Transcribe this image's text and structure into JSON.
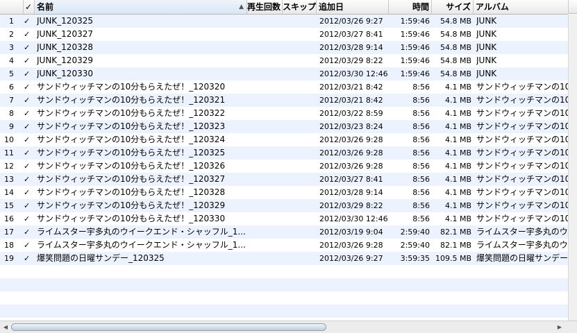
{
  "columns": {
    "check": "✓",
    "name": "名前",
    "plays": "再生回数",
    "skips": "スキップ回数",
    "date_added": "追加日",
    "time": "時間",
    "size": "サイズ",
    "album": "アルバム"
  },
  "rows": [
    {
      "num": "1",
      "check": "✓",
      "name": "JUNK_120325",
      "date": "2012/03/26 9:27",
      "time": "1:59:46",
      "size": "54.8 MB",
      "album": "JUNK"
    },
    {
      "num": "2",
      "check": "✓",
      "name": "JUNK_120327",
      "date": "2012/03/27 8:41",
      "time": "1:59:46",
      "size": "54.8 MB",
      "album": "JUNK"
    },
    {
      "num": "3",
      "check": "✓",
      "name": "JUNK_120328",
      "date": "2012/03/28 9:14",
      "time": "1:59:46",
      "size": "54.8 MB",
      "album": "JUNK"
    },
    {
      "num": "4",
      "check": "✓",
      "name": "JUNK_120329",
      "date": "2012/03/29 8:22",
      "time": "1:59:46",
      "size": "54.8 MB",
      "album": "JUNK"
    },
    {
      "num": "5",
      "check": "✓",
      "name": "JUNK_120330",
      "date": "2012/03/30 12:46",
      "time": "1:59:46",
      "size": "54.8 MB",
      "album": "JUNK"
    },
    {
      "num": "6",
      "check": "✓",
      "name": "サンドウィッチマンの10分もらえたぜ！_120320",
      "date": "2012/03/21 8:42",
      "time": "8:56",
      "size": "4.1 MB",
      "album": "サンドウィッチマンの10"
    },
    {
      "num": "7",
      "check": "✓",
      "name": "サンドウィッチマンの10分もらえたぜ！_120321",
      "date": "2012/03/21 8:42",
      "time": "8:56",
      "size": "4.1 MB",
      "album": "サンドウィッチマンの10"
    },
    {
      "num": "8",
      "check": "✓",
      "name": "サンドウィッチマンの10分もらえたぜ！_120322",
      "date": "2012/03/22 8:59",
      "time": "8:56",
      "size": "4.1 MB",
      "album": "サンドウィッチマンの10"
    },
    {
      "num": "9",
      "check": "✓",
      "name": "サンドウィッチマンの10分もらえたぜ！_120323",
      "date": "2012/03/23 8:24",
      "time": "8:56",
      "size": "4.1 MB",
      "album": "サンドウィッチマンの10"
    },
    {
      "num": "10",
      "check": "✓",
      "name": "サンドウィッチマンの10分もらえたぜ！_120324",
      "date": "2012/03/26 9:28",
      "time": "8:56",
      "size": "4.1 MB",
      "album": "サンドウィッチマンの10"
    },
    {
      "num": "11",
      "check": "✓",
      "name": "サンドウィッチマンの10分もらえたぜ！_120325",
      "date": "2012/03/26 9:28",
      "time": "8:56",
      "size": "4.1 MB",
      "album": "サンドウィッチマンの10"
    },
    {
      "num": "12",
      "check": "✓",
      "name": "サンドウィッチマンの10分もらえたぜ！_120326",
      "date": "2012/03/26 9:28",
      "time": "8:56",
      "size": "4.1 MB",
      "album": "サンドウィッチマンの10"
    },
    {
      "num": "13",
      "check": "✓",
      "name": "サンドウィッチマンの10分もらえたぜ！_120327",
      "date": "2012/03/27 8:41",
      "time": "8:56",
      "size": "4.1 MB",
      "album": "サンドウィッチマンの10"
    },
    {
      "num": "14",
      "check": "✓",
      "name": "サンドウィッチマンの10分もらえたぜ！_120328",
      "date": "2012/03/28 9:14",
      "time": "8:56",
      "size": "4.1 MB",
      "album": "サンドウィッチマンの10"
    },
    {
      "num": "15",
      "check": "✓",
      "name": "サンドウィッチマンの10分もらえたぜ！_120329",
      "date": "2012/03/29 8:22",
      "time": "8:56",
      "size": "4.1 MB",
      "album": "サンドウィッチマンの10"
    },
    {
      "num": "16",
      "check": "✓",
      "name": "サンドウィッチマンの10分もらえたぜ！_120330",
      "date": "2012/03/30 12:46",
      "time": "8:56",
      "size": "4.1 MB",
      "album": "サンドウィッチマンの10"
    },
    {
      "num": "17",
      "check": "✓",
      "name": "ライムスター宇多丸のウイークエンド・シャッフル_1...",
      "date": "2012/03/19 9:04",
      "time": "2:59:40",
      "size": "82.1 MB",
      "album": "ライムスター宇多丸のウ"
    },
    {
      "num": "18",
      "check": "✓",
      "name": "ライムスター宇多丸のウイークエンド・シャッフル_1...",
      "date": "2012/03/26 9:28",
      "time": "2:59:40",
      "size": "82.1 MB",
      "album": "ライムスター宇多丸のウ"
    },
    {
      "num": "19",
      "check": "✓",
      "name": "爆笑問題の日曜サンデー_120325",
      "date": "2012/03/26 9:27",
      "time": "3:59:35",
      "size": "109.5 MB",
      "album": "爆笑問題の日曜サンデー"
    }
  ],
  "icons": {
    "sort": "sort-ascending-icon",
    "scroll_left": "scroll-left-arrow-icon",
    "scroll_right": "scroll-right-arrow-icon"
  },
  "colors": {
    "alt_row": "#edf3fe",
    "header": "#e8e8e8"
  },
  "hscroll_thumb_fraction": 0.58
}
